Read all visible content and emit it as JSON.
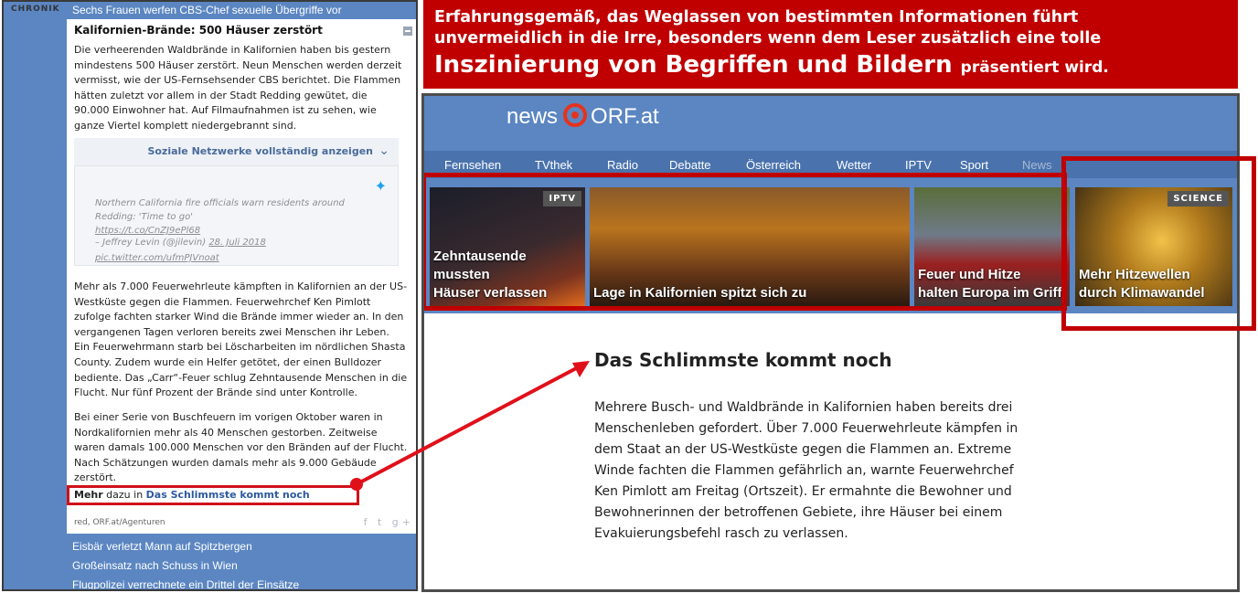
{
  "chronik": {
    "label": "CHRONIK",
    "top_link": "Sechs Frauen werfen CBS-Chef sexuelle Übergriffe vor",
    "article": {
      "title": "Kalifornien-Brände: 500 Häuser zerstört",
      "para1": "Die verheerenden Waldbrände in Kalifornien haben bis gestern\nmindestens 500 Häuser zerstört. Neun Menschen werden derzeit\nvermisst, wie der US-Fernsehsender CBS berichtet. Die Flammen\nhätten zuletzt vor allem in der Stadt Redding gewütet, die\n90.000 Einwohner hat. Auf Filmaufnahmen ist zu sehen, wie\nganze Viertel komplett niedergebrannt sind.",
      "social_toggle": "Soziale Netzwerke vollständig anzeigen",
      "tweet_text": "Northern California fire officials warn residents around\nRedding: 'Time to go'",
      "tweet_link1": "https://t.co/CnZJ9ePl68",
      "tweet_link2": "pic.twitter.com/ufmPJVnoat",
      "tweet_author": "– Jeffrey Levin (@jilevin)",
      "tweet_date": "28. Juli 2018",
      "para2": "Mehr als 7.000 Feuerwehrleute kämpften in Kalifornien an der US-\nWestküste gegen die Flammen. Feuerwehrchef Ken Pimlott\nzufolge fachten starker Wind die Brände immer wieder an. In den\nvergangenen Tagen verloren bereits zwei Menschen ihr Leben.\nEin Feuerwehrmann starb bei Löscharbeiten im nördlichen Shasta\nCounty. Zudem wurde ein Helfer getötet, der einen Bulldozer\nbediente. Das „Carr“-Feuer schlug Zehntausende Menschen in die\nFlucht. Nur fünf Prozent der Brände sind unter Kontrolle.",
      "para3": "Bei einer Serie von Buschfeuern im vorigen Oktober waren in\nNordkalifornien mehr als 40 Menschen gestorben. Zeitweise\nwaren damals 100.000 Menschen vor den Bränden auf der Flucht.\nNach Schätzungen wurden damals mehr als 9.000 Gebäude\nzerstört.",
      "mehr_prefix": "Mehr",
      "mehr_middle": "dazu in",
      "mehr_link": "Das Schlimmste kommt noch",
      "source": "red, ORF.at/Agenturen"
    },
    "more_links": [
      "Eisbär verletzt Mann auf Spitzbergen",
      "Großeinsatz nach Schuss in Wien",
      "Flugpolizei verrechnete ein Drittel der Einsätze"
    ]
  },
  "banner": {
    "line1": "Erfahrungsgemäß, das Weglassen von bestimmten Informationen führt",
    "line2": "unvermeidlich in die Irre, besonders wenn dem Leser zusätzlich eine tolle",
    "line3_big": "Inszinierung von Begriffen und Bildern",
    "line3_small": "präsentiert wird."
  },
  "orf": {
    "logo_left": "news",
    "logo_right": "ORF.at",
    "nav": [
      "Fernsehen",
      "TVthek",
      "Radio",
      "Debatte",
      "Österreich",
      "Wetter",
      "IPTV",
      "Sport",
      "News"
    ],
    "tiles": [
      {
        "tag": "IPTV",
        "caption": "Zehntausende mussten\nHäuser verlassen"
      },
      {
        "tag": "",
        "caption": "Lage in Kalifornien spitzt sich zu"
      },
      {
        "tag": "",
        "caption": "Feuer und Hitze\nhalten Europa im Griff"
      },
      {
        "tag": "SCIENCE",
        "caption": "Mehr Hitzewellen\ndurch Klimawandel"
      }
    ],
    "headline": "Das Schlimmste kommt noch",
    "body": "Mehrere Busch- und Waldbrände in Kalifornien haben bereits drei\nMenschenleben gefordert. Über 7.000 Feuerwehrleute kämpfen in\ndem Staat an der US-Westküste gegen die Flammen an. Extreme\nWinde fachten die Flammen gefährlich an, warnte Feuerwehrchef\nKen Pimlott am Freitag (Ortszeit). Er ermahnte die Bewohner und\nBewohnerinnen der betroffenen Gebiete, ihre Häuser bei einem\nEvakuierungsbefehl rasch zu verlassen."
  },
  "colors": {
    "highlight_red": "#c00000",
    "orf_blue": "#5b86c2",
    "orf_red": "#e5331e"
  }
}
